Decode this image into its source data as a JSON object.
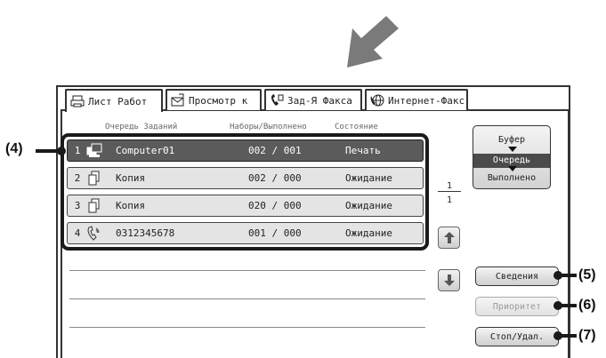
{
  "tabs": [
    {
      "label": "Лист Работ",
      "icon": "printer-icon",
      "active": true
    },
    {
      "label": "Просмотр к",
      "icon": "scan-envelope-icon",
      "active": false
    },
    {
      "label": "Зад-Я Факса",
      "icon": "fax-phone-icon",
      "active": false
    },
    {
      "label": "Интернет-Факс",
      "icon": "internet-fax-icon",
      "active": false
    }
  ],
  "columns": {
    "queue": "Очередь Заданий",
    "counts": "Наборы/Выполнено",
    "status": "Состояние"
  },
  "jobs": [
    {
      "index": "1",
      "icon": "computer-job-icon",
      "name": "Computer01",
      "counts": "002 / 001",
      "status": "Печать",
      "selected": true
    },
    {
      "index": "2",
      "icon": "copy-job-icon",
      "name": "Копия",
      "counts": "002 / 000",
      "status": "Ожидание",
      "selected": false
    },
    {
      "index": "3",
      "icon": "copy-job-icon",
      "name": "Копия",
      "counts": "020 / 000",
      "status": "Ожидание",
      "selected": false
    },
    {
      "index": "4",
      "icon": "fax-job-icon",
      "name": "0312345678",
      "counts": "001 / 000",
      "status": "Ожидание",
      "selected": false
    }
  ],
  "modes": {
    "spool": "Буфер",
    "queue": "Очередь",
    "complete": "Выполнено",
    "selected": "queue"
  },
  "pager": {
    "current": "1",
    "total": "1"
  },
  "buttons": {
    "details": "Сведения",
    "priority": "Приоритет",
    "stop_delete": "Стоп/Удал."
  },
  "callouts": {
    "c4": "(4)",
    "c5": "(5)",
    "c6": "(6)",
    "c7": "(7)"
  },
  "colors": {
    "selected_row": "#5b5b5b",
    "row_bg": "#e4e4e4",
    "arrow": "#7a7a7a"
  }
}
